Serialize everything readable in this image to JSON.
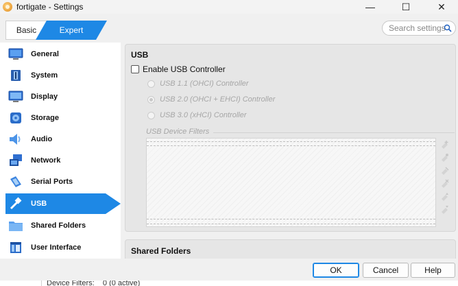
{
  "window": {
    "title": "fortigate - Settings",
    "minimize_glyph": "—",
    "maximize_glyph": "☐",
    "close_glyph": "✕"
  },
  "mode": {
    "basic_label": "Basic",
    "expert_label": "Expert",
    "active": "Expert"
  },
  "search": {
    "placeholder": "Search settings"
  },
  "sidebar": {
    "active": "USB",
    "items": [
      {
        "label": "General",
        "icon": "general-icon"
      },
      {
        "label": "System",
        "icon": "system-icon"
      },
      {
        "label": "Display",
        "icon": "display-icon"
      },
      {
        "label": "Storage",
        "icon": "storage-icon"
      },
      {
        "label": "Audio",
        "icon": "audio-icon"
      },
      {
        "label": "Network",
        "icon": "network-icon"
      },
      {
        "label": "Serial Ports",
        "icon": "serial-ports-icon"
      },
      {
        "label": "USB",
        "icon": "usb-icon"
      },
      {
        "label": "Shared Folders",
        "icon": "shared-folders-icon"
      },
      {
        "label": "User Interface",
        "icon": "user-interface-icon"
      }
    ]
  },
  "usb": {
    "section_title": "USB",
    "enable_label": "Enable USB Controller",
    "enable_checked": false,
    "controllers": [
      {
        "label": "USB 1.1 (OHCI) Controller",
        "checked": false,
        "enabled": false
      },
      {
        "label": "USB 2.0 (OHCI + EHCI) Controller",
        "checked": true,
        "enabled": false
      },
      {
        "label": "USB 3.0 (xHCI) Controller",
        "checked": false,
        "enabled": false
      }
    ],
    "filters_label": "USB Device Filters",
    "filters_tools": [
      "add-filter-icon",
      "add-from-device-icon",
      "edit-filter-icon",
      "remove-filter-icon",
      "move-up-icon",
      "move-down-icon"
    ]
  },
  "shared_folders": {
    "section_title": "Shared Folders"
  },
  "footer": {
    "ok_label": "OK",
    "cancel_label": "Cancel",
    "help_label": "Help"
  },
  "background": {
    "text": "Device Filters:    0 (0 active)"
  },
  "colors": {
    "accent": "#1e88e5",
    "disabled_text": "#a6a6a6"
  }
}
